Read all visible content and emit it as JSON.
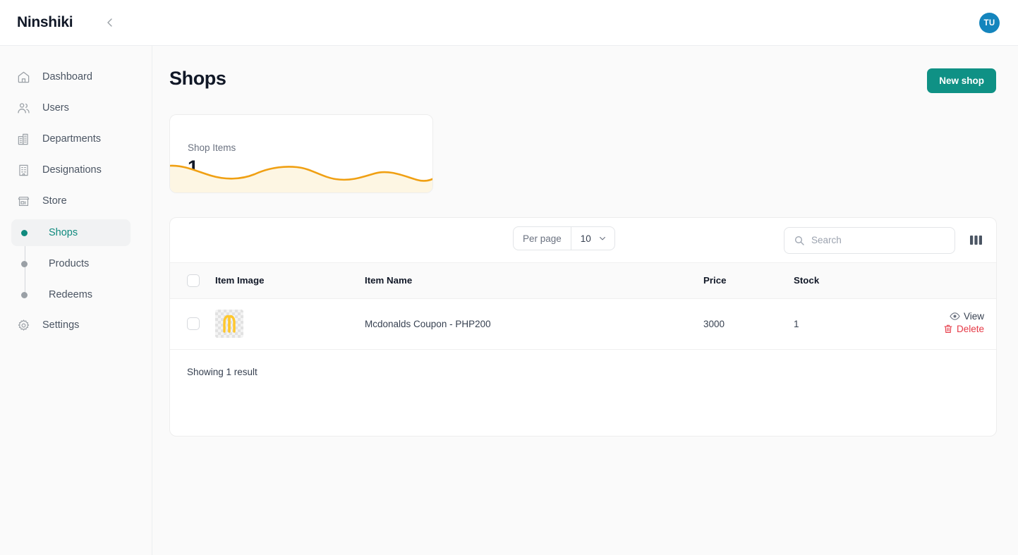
{
  "app": {
    "brand": "Ninshiki",
    "collapse_icon": "chevron-left-icon",
    "avatar_initials": "TU",
    "avatar_color": "#1485bd",
    "accent_color": "#0f9185"
  },
  "sidebar": {
    "items": [
      {
        "label": "Dashboard",
        "icon": "home-icon"
      },
      {
        "label": "Users",
        "icon": "users-icon"
      },
      {
        "label": "Departments",
        "icon": "building-icon"
      },
      {
        "label": "Designations",
        "icon": "office-icon"
      },
      {
        "label": "Store",
        "icon": "store-icon"
      }
    ],
    "sub_items": [
      {
        "label": "Shops",
        "active": true
      },
      {
        "label": "Products",
        "active": false
      },
      {
        "label": "Redeems",
        "active": false
      }
    ],
    "settings": {
      "label": "Settings",
      "icon": "gear-icon"
    }
  },
  "main": {
    "title": "Shops",
    "new_button": "New shop",
    "stat_card": {
      "label": "Shop Items",
      "value": "1",
      "spark_color": "#f0a013",
      "spark_fill": "#fdf6e3"
    },
    "toolbar": {
      "search_placeholder": "Search",
      "search_value": "",
      "search_icon": "search-icon",
      "columns_icon": "columns-icon"
    },
    "table": {
      "columns": [
        "Item Image",
        "Item Name",
        "Price",
        "Stock"
      ],
      "rows": [
        {
          "image_alt": "mcdonalds-logo",
          "name": "Mcdonalds Coupon - PHP200",
          "price": "3000",
          "stock": "1",
          "view_label": "View",
          "delete_label": "Delete"
        }
      ]
    },
    "footer": {
      "showing": "Showing 1 result",
      "per_page_label": "Per page",
      "per_page_value": "10",
      "chevron_icon": "chevron-down-icon"
    }
  }
}
